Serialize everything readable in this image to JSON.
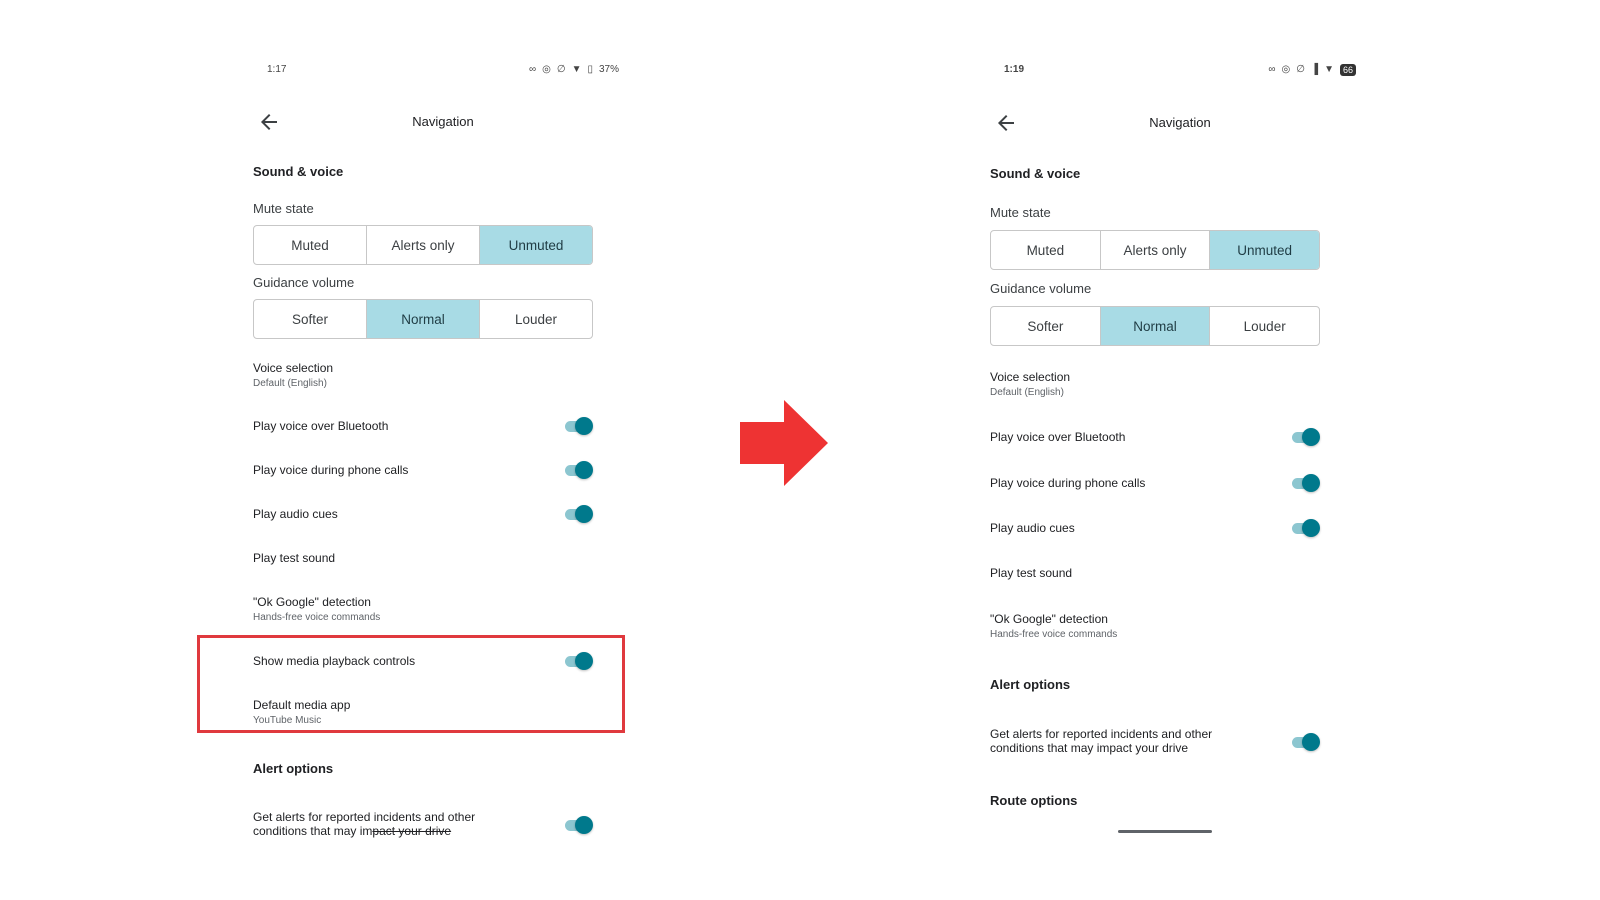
{
  "left": {
    "status": {
      "time": "1:17",
      "battery": "37%"
    },
    "title": "Navigation",
    "sound_voice": "Sound & voice",
    "mute_state": {
      "label": "Mute state",
      "options": [
        "Muted",
        "Alerts only",
        "Unmuted"
      ],
      "selected": "Unmuted"
    },
    "guidance_volume": {
      "label": "Guidance volume",
      "options": [
        "Softer",
        "Normal",
        "Louder"
      ],
      "selected": "Normal"
    },
    "voice_selection": {
      "title": "Voice selection",
      "subtitle": "Default (English)"
    },
    "toggles": [
      {
        "label": "Play voice over Bluetooth",
        "on": true
      },
      {
        "label": "Play voice during phone calls",
        "on": true
      },
      {
        "label": "Play audio cues",
        "on": true
      }
    ],
    "play_test_sound": "Play test sound",
    "ok_google": {
      "title": "\"Ok Google\" detection",
      "subtitle": "Hands-free voice commands"
    },
    "media_playback": {
      "label": "Show media playback controls",
      "on": true
    },
    "default_media_app": {
      "title": "Default media app",
      "subtitle": "YouTube Music"
    },
    "alert_options": "Alert options",
    "alerts": {
      "line1": "Get alerts for reported incidents and other",
      "line2_start": "conditions that may im",
      "line2_struck": "pact your drive",
      "on": true
    }
  },
  "right": {
    "status": {
      "time": "1:19",
      "battery": "66"
    },
    "title": "Navigation",
    "sound_voice": "Sound & voice",
    "mute_state": {
      "label": "Mute state",
      "options": [
        "Muted",
        "Alerts only",
        "Unmuted"
      ],
      "selected": "Unmuted"
    },
    "guidance_volume": {
      "label": "Guidance volume",
      "options": [
        "Softer",
        "Normal",
        "Louder"
      ],
      "selected": "Normal"
    },
    "voice_selection": {
      "title": "Voice selection",
      "subtitle": "Default (English)"
    },
    "toggles": [
      {
        "label": "Play voice over Bluetooth",
        "on": true
      },
      {
        "label": "Play voice during phone calls",
        "on": true
      },
      {
        "label": "Play audio cues",
        "on": true
      }
    ],
    "play_test_sound": "Play test sound",
    "ok_google": {
      "title": "\"Ok Google\" detection",
      "subtitle": "Hands-free voice commands"
    },
    "alert_options": "Alert options",
    "alerts": {
      "line1": "Get alerts for reported incidents and other",
      "line2": "conditions that may impact your drive",
      "on": true
    },
    "route_options": "Route options"
  },
  "colors": {
    "selected_segment": "#a8dbe5",
    "toggle_knob": "#00798c",
    "toggle_track": "#8cc6d0",
    "highlight": "#e0393e",
    "arrow": "#ee3333"
  },
  "icons": [
    "back-arrow-icon",
    "link-icon",
    "location-icon",
    "mute-icon",
    "signal-icon",
    "wifi-icon",
    "battery-icon",
    "right-arrow-icon"
  ]
}
